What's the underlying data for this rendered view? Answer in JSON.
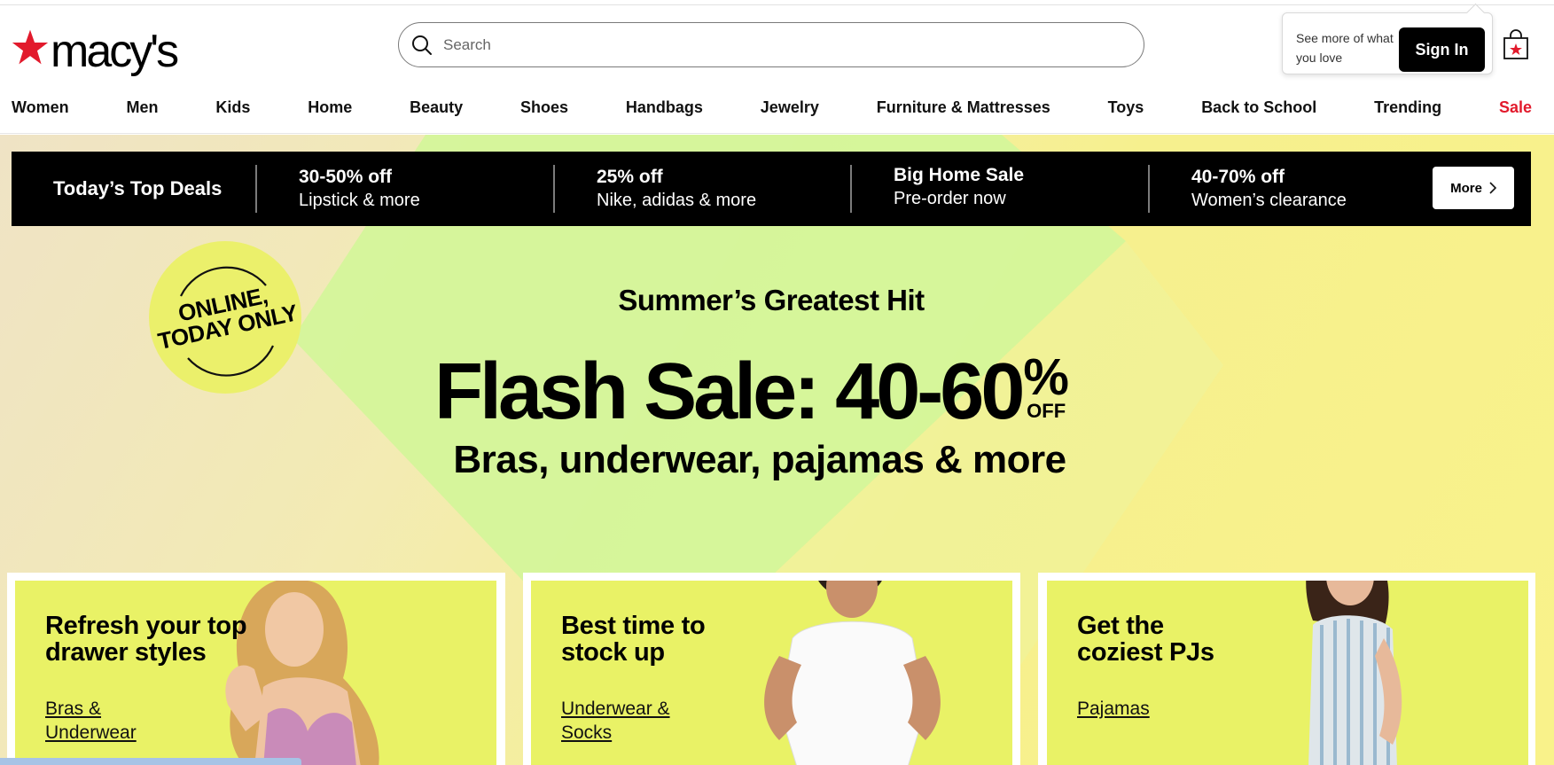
{
  "brand": {
    "name": "macy's",
    "accent": "#e21a2c"
  },
  "search": {
    "placeholder": "Search"
  },
  "signin": {
    "prompt": "See more of what you love",
    "button_label": "Sign In"
  },
  "nav": {
    "items": [
      "Women",
      "Men",
      "Kids",
      "Home",
      "Beauty",
      "Shoes",
      "Handbags",
      "Jewelry",
      "Furniture & Mattresses",
      "Toys",
      "Back to School",
      "Trending",
      "Sale"
    ]
  },
  "deals": {
    "title": "Today’s Top Deals",
    "items": [
      {
        "head": "30-50% off",
        "sub": "Lipstick & more"
      },
      {
        "head": "25% off",
        "sub": "Nike, adidas & more"
      },
      {
        "head": "Big Home Sale",
        "sub": "Pre-order now"
      },
      {
        "head": "40-70% off",
        "sub": "Women’s clearance"
      }
    ],
    "more_label": "More"
  },
  "hero": {
    "badge": "ONLINE, TODAY ONLY",
    "eyebrow": "Summer’s Greatest Hit",
    "headline": "Flash Sale: 40-60",
    "percent": "%",
    "off": "OFF",
    "subhead": "Bras, underwear, pajamas & more"
  },
  "promos": [
    {
      "title": "Refresh your top drawer styles",
      "link": "Bras & Underwear"
    },
    {
      "title": "Best time to stock up",
      "link": "Underwear & Socks"
    },
    {
      "title": "Get the coziest PJs",
      "link": "Pajamas"
    }
  ]
}
